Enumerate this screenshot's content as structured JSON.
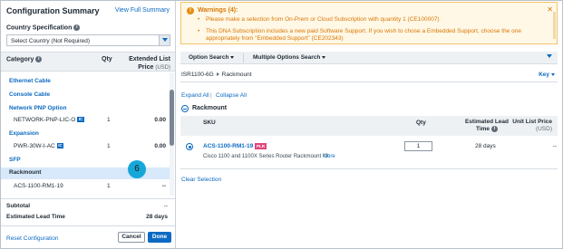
{
  "summary": {
    "title": "Configuration Summary",
    "view_full": "View Full Summary",
    "country_label": "Country Specification",
    "country_value": "Select Country (Not Required)",
    "headers": {
      "category": "Category",
      "qty": "Qty",
      "price_line1": "Extended List",
      "price_line2": "Price",
      "price_unit": "(USD)"
    },
    "rows": [
      {
        "kind": "category",
        "label": "Ethernet Cable"
      },
      {
        "kind": "category",
        "label": "Console Cable"
      },
      {
        "kind": "category",
        "label": "Network PNP Option"
      },
      {
        "kind": "item",
        "label": "NETWORK-PNP-LIC-O",
        "badge": "IC",
        "qty": "1",
        "price": "0.00"
      },
      {
        "kind": "category",
        "label": "Expansion"
      },
      {
        "kind": "item",
        "label": "PWR-30W-I-AC",
        "badge": "IC",
        "qty": "1",
        "price": "0.00"
      },
      {
        "kind": "category",
        "label": "SFP"
      },
      {
        "kind": "category",
        "label": "Rackmount",
        "selected": true
      },
      {
        "kind": "item",
        "label": "ACS-1100-RM1-19",
        "qty": "1",
        "price": "--"
      }
    ],
    "step_badge": "6",
    "subtotal_label": "Subtotal",
    "subtotal_value": "--",
    "lead_label": "Estimated Lead Time",
    "lead_value": "28 days",
    "reset": "Reset Configuration",
    "cancel": "Cancel",
    "done": "Done"
  },
  "warnings": {
    "title": "Warnings (4):",
    "items": [
      "Please make a selection from On-Prem or Cloud Subscription with quantity 1 (CE100007)",
      "This DNA Subscription includes a new paid Software Support. If you wish to chose a Embedded Support, choose the one appropriately from \"Embedded Support\" (CE202343)"
    ],
    "bullet": "•",
    "close": "✕"
  },
  "tabs": {
    "option_search": "Option Search",
    "multiple_search": "Multiple Options Search"
  },
  "breadcrumb": {
    "product": "ISR1100-6G",
    "section": "Rackmount"
  },
  "key_label": "Key",
  "expand_all": "Expand All",
  "collapse_all": "Collapse All",
  "separator": "|",
  "group": {
    "label": "Rackmount"
  },
  "table": {
    "sku": "SKU",
    "qty": "Qty",
    "lead_line1": "Estimated Lead",
    "lead_line2": "Time",
    "price_line1": "Unit List Price",
    "price_unit": "(USD)"
  },
  "option": {
    "sku": "ACS-1100-RM1-19",
    "badge": "PLR",
    "description": "Cisco 1100 and 1100X Series Router Rackmount Kit",
    "more": "More",
    "qty": "1",
    "lead": "28 days",
    "price": "--"
  },
  "clear_selection": "Clear Selection",
  "colors": {
    "accent": "#0b6ac2",
    "warning": "#d97706",
    "selected_row": "#d7e9fa",
    "step_badge": "#16a7d9",
    "plr_badge": "#e0457b"
  }
}
